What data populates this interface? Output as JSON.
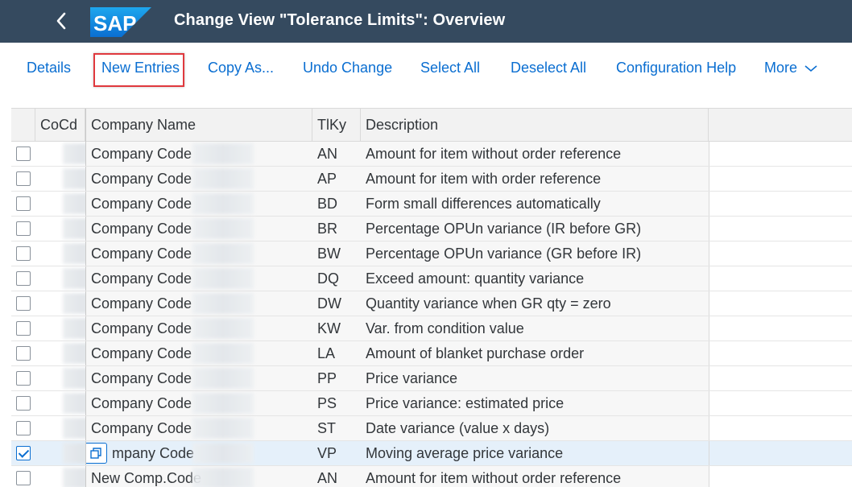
{
  "header": {
    "title": "Change View \"Tolerance Limits\": Overview",
    "logo_text": "SAP",
    "logo_color": "#0a6ed1",
    "background": "#354a5f"
  },
  "toolbar": {
    "details": "Details",
    "new_entries": "New Entries",
    "copy_as": "Copy As...",
    "undo_change": "Undo Change",
    "select_all": "Select All",
    "deselect_all": "Deselect All",
    "configuration_help": "Configuration Help",
    "more": "More"
  },
  "table": {
    "columns": [
      "CoCd",
      "Company Name",
      "TlKy",
      "Description"
    ],
    "rows": [
      {
        "name": "Company Code",
        "tlky": "AN",
        "desc": "Amount for item without order reference",
        "checked": false
      },
      {
        "name": "Company Code",
        "tlky": "AP",
        "desc": "Amount for item with order reference",
        "checked": false
      },
      {
        "name": "Company Code",
        "tlky": "BD",
        "desc": "Form small differences automatically",
        "checked": false
      },
      {
        "name": "Company Code",
        "tlky": "BR",
        "desc": "Percentage OPUn variance (IR before GR)",
        "checked": false
      },
      {
        "name": "Company Code",
        "tlky": "BW",
        "desc": "Percentage OPUn variance (GR before IR)",
        "checked": false
      },
      {
        "name": "Company Code",
        "tlky": "DQ",
        "desc": "Exceed amount: quantity variance",
        "checked": false
      },
      {
        "name": "Company Code",
        "tlky": "DW",
        "desc": "Quantity variance when GR qty = zero",
        "checked": false
      },
      {
        "name": "Company Code",
        "tlky": "KW",
        "desc": "Var. from condition value",
        "checked": false
      },
      {
        "name": "Company Code",
        "tlky": "LA",
        "desc": "Amount of blanket purchase order",
        "checked": false
      },
      {
        "name": "Company Code",
        "tlky": "PP",
        "desc": "Price variance",
        "checked": false
      },
      {
        "name": "Company Code",
        "tlky": "PS",
        "desc": "Price variance: estimated price",
        "checked": false
      },
      {
        "name": "Company Code",
        "tlky": "ST",
        "desc": "Date variance (value x days)",
        "checked": false
      },
      {
        "name": "mpany Code",
        "tlky": "VP",
        "desc": "Moving average price variance",
        "checked": true
      },
      {
        "name": "New Comp.Code",
        "tlky": "AN",
        "desc": "Amount for item without order reference",
        "checked": false
      }
    ]
  },
  "colors": {
    "link": "#0a6ed1",
    "highlight_border": "#e0393e",
    "selected_row": "#e5f0fa"
  }
}
